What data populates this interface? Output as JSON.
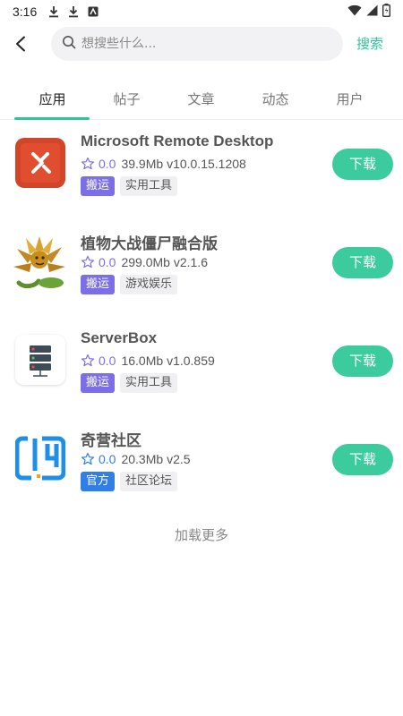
{
  "status_bar": {
    "time": "3:16"
  },
  "search": {
    "placeholder": "想搜些什么...",
    "button_label": "搜索"
  },
  "tabs": [
    {
      "label": "应用",
      "active": true
    },
    {
      "label": "帖子"
    },
    {
      "label": "文章"
    },
    {
      "label": "动态"
    },
    {
      "label": "用户"
    }
  ],
  "apps": [
    {
      "name": "Microsoft Remote Desktop",
      "rating": "0.0",
      "size": "39.9Mb",
      "version": "v10.0.15.1208",
      "source_tag": "搬运",
      "category_tag": "实用工具",
      "download_label": "下载",
      "icon": "remote-desktop-icon"
    },
    {
      "name": "植物大战僵尸融合版",
      "rating": "0.0",
      "size": "299.0Mb",
      "version": "v2.1.6",
      "source_tag": "搬运",
      "category_tag": "游戏娱乐",
      "download_label": "下载",
      "icon": "plant-icon"
    },
    {
      "name": "ServerBox",
      "rating": "0.0",
      "size": "16.0Mb",
      "version": "v1.0.859",
      "source_tag": "搬运",
      "category_tag": "实用工具",
      "download_label": "下载",
      "icon": "server-icon"
    },
    {
      "name": "奇营社区",
      "rating": "0.0",
      "size": "20.3Mb",
      "version": "v2.5",
      "source_tag": "官方",
      "category_tag": "社区论坛",
      "download_label": "下载",
      "icon": "community-icon"
    }
  ],
  "load_more": "加载更多",
  "colors": {
    "accent": "#3ccb9c",
    "rating": "#7c6ee6",
    "official": "#2f7fe6"
  }
}
